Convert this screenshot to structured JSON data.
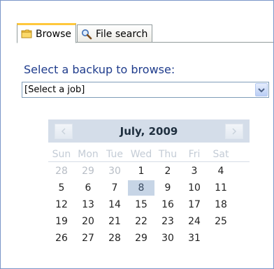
{
  "tabs": [
    {
      "label": "Browse",
      "icon": "folder-icon",
      "active": true
    },
    {
      "label": "File search",
      "icon": "magnifier-icon",
      "active": false
    }
  ],
  "select_label": "Select a backup to browse:",
  "job_select": {
    "value": "[Select a job]"
  },
  "calendar": {
    "title": "July, 2009",
    "weekdays": [
      "Sun",
      "Mon",
      "Tue",
      "Wed",
      "Thu",
      "Fri",
      "Sat"
    ],
    "weeks": [
      [
        "28",
        "29",
        "30",
        "1",
        "2",
        "3",
        "4"
      ],
      [
        "5",
        "6",
        "7",
        "8",
        "9",
        "10",
        "11"
      ],
      [
        "12",
        "13",
        "14",
        "15",
        "16",
        "17",
        "18"
      ],
      [
        "19",
        "20",
        "21",
        "22",
        "23",
        "24",
        "25"
      ],
      [
        "26",
        "27",
        "28",
        "29",
        "30",
        "31",
        ""
      ]
    ],
    "selected_day": "8"
  },
  "colors": {
    "accent": "#1f3c8c",
    "header_bg": "#d4dde9",
    "selected_bg": "#c7d5e6"
  }
}
